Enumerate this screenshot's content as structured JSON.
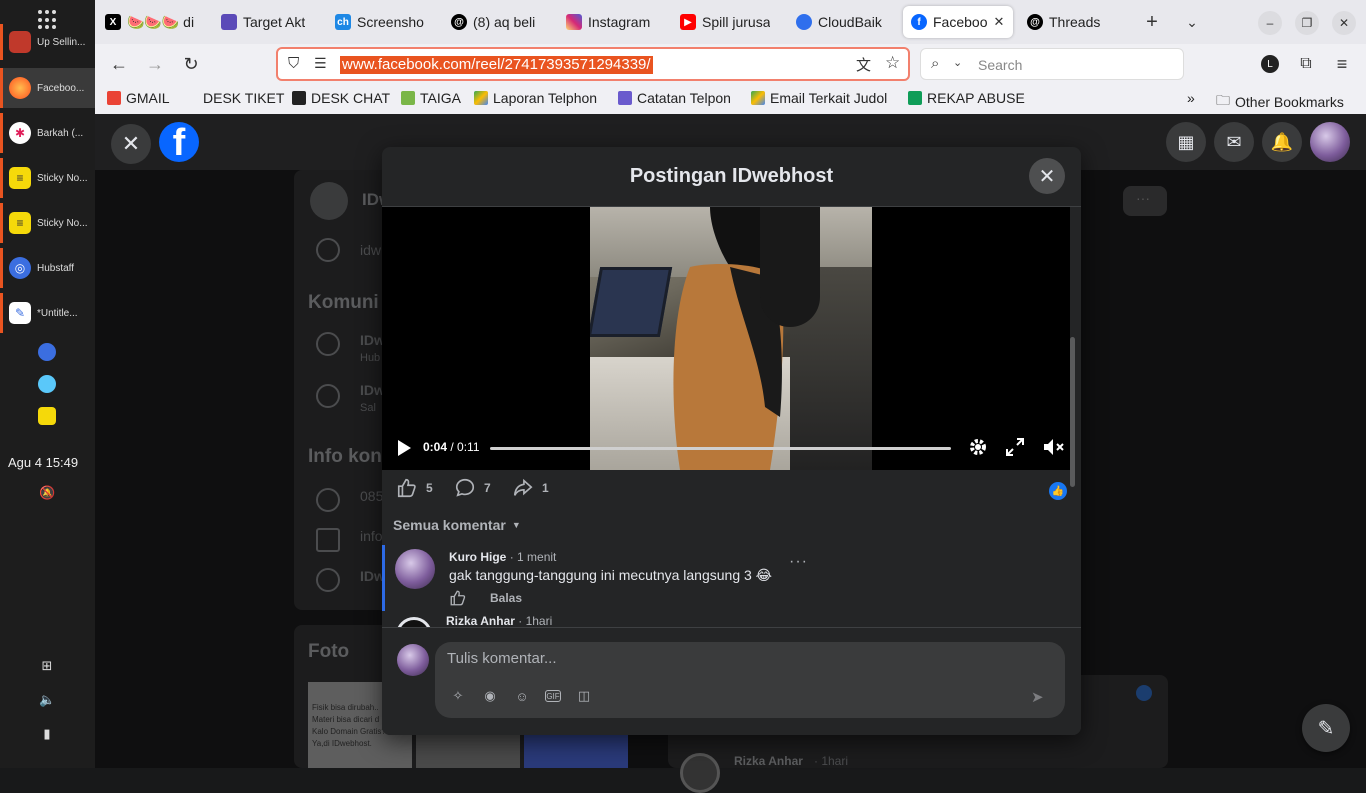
{
  "dock": {
    "items": [
      {
        "label": "Up Sellin...",
        "color": "#e95420"
      },
      {
        "label": "Faceboo...",
        "color": "#ff7139"
      },
      {
        "label": "Barkah (...",
        "color": "#4a154b"
      },
      {
        "label": "Sticky No...",
        "color": "#f5d90a"
      },
      {
        "label": "Sticky No...",
        "color": "#f5d90a"
      },
      {
        "label": "Hubstaff",
        "color": "#3b6ee0"
      },
      {
        "label": "*Untitle...",
        "color": "#ffffff"
      }
    ],
    "clock": "Agu 4  15:49"
  },
  "browser": {
    "tabs": [
      {
        "title": "🍉🍉🍉 di",
        "fav": "X",
        "fav_color": "#000000"
      },
      {
        "title": "Target Akt",
        "fav": "",
        "fav_color": "#5b4ab8"
      },
      {
        "title": "Screensho",
        "fav": "ch",
        "fav_color": "#1e88e5"
      },
      {
        "title": "(8) aq beli",
        "fav": "@",
        "fav_color": "#000000"
      },
      {
        "title": "Instagram",
        "fav": "",
        "fav_color": "#e1306c"
      },
      {
        "title": "Spill jurusa",
        "fav": "▶",
        "fav_color": "#ff0000"
      },
      {
        "title": "CloudBaik",
        "fav": "",
        "fav_color": "#2f6fed"
      },
      {
        "title": "Faceboo",
        "fav": "f",
        "fav_color": "#0866ff"
      },
      {
        "title": "Threads",
        "fav": "@",
        "fav_color": "#000000"
      }
    ],
    "url": "www.facebook.com/reel/27417393571294339/",
    "search_placeholder": "Search",
    "profile_letter": "L",
    "bookmarks": [
      {
        "label": "GMAIL",
        "color": "#ea4335"
      },
      {
        "label": "DESK TIKET",
        "color": ""
      },
      {
        "label": "DESK CHAT",
        "color": "#222222"
      },
      {
        "label": "TAIGA",
        "color": "#7ab648"
      },
      {
        "label": "Laporan Telphon",
        "color": "#34a853"
      },
      {
        "label": "Catatan Telpon",
        "color": "#6a5acd"
      },
      {
        "label": "Email Terkait Judol",
        "color": "#fbbc04"
      },
      {
        "label": "REKAP ABUSE",
        "color": "#0f9d58"
      }
    ],
    "other_bookmarks": "Other Bookmarks"
  },
  "background_page": {
    "name": "IDw",
    "link": "idw",
    "section1": "Komuni",
    "item1": "IDw",
    "item1_sub": "Hub",
    "item2": "IDw",
    "item2_sub": "Sal",
    "section2": "Info kon",
    "phone": "085",
    "email": "info",
    "messenger": "IDw",
    "photos": "Foto",
    "photo_text": "Fisik bisa dirubah..\nMateri bisa dicari d\nKalo Domain Gratis?\nYa,di IDwebhost.",
    "bg_commenter": "Rizka Anhar",
    "bg_commenter_time": "· 1hari"
  },
  "modal": {
    "title": "Postingan IDwebhost",
    "video": {
      "current": "0:04",
      "duration": "0:11",
      "progress": 0.0
    },
    "reactions": {
      "likes": "5",
      "comments": "7",
      "shares": "1"
    },
    "sort_label": "Semua komentar",
    "comments": [
      {
        "name": "Kuro Hige",
        "time": "· 1 menit",
        "text": "gak tanggung-tanggung ini mecutnya langsung 3 😂",
        "reply": "Balas"
      },
      {
        "name": "Rizka Anhar",
        "time": "· 1hari"
      }
    ],
    "compose_placeholder": "Tulis komentar..."
  }
}
